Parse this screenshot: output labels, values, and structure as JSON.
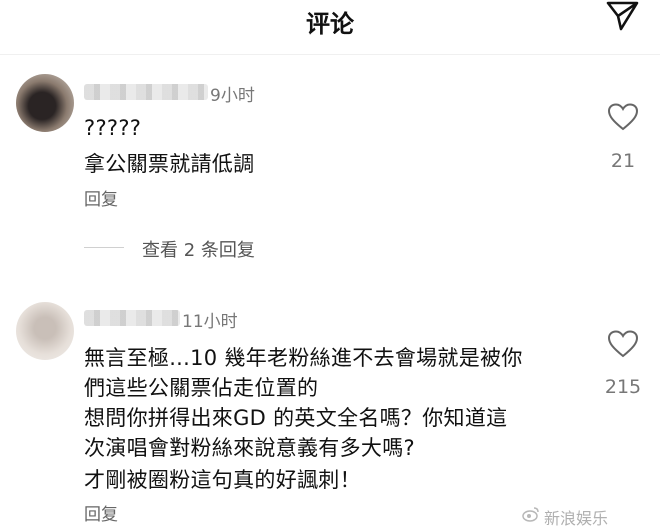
{
  "header": {
    "title": "评论"
  },
  "comments": [
    {
      "time": "9小时",
      "lines": [
        "?????",
        "拿公關票就請低調"
      ],
      "reply_label": "回复",
      "likes": "21",
      "view_replies": "查看 2 条回复"
    },
    {
      "time": "11小时",
      "lines": [
        "無言至極...10 幾年老粉絲進不去會場就是被你",
        "們這些公關票佔走位置的",
        "想問你拼得出來GD 的英文全名嗎？你知道這",
        "次演唱會對粉絲來說意義有多大嗎?",
        "才剛被圈粉這句真的好諷刺！"
      ],
      "reply_label": "回复",
      "likes": "215"
    }
  ],
  "watermark": {
    "text": "新浪娱乐",
    "icon": "weibo-icon"
  },
  "icons": {
    "send": "send-icon",
    "like": "heart-icon"
  }
}
